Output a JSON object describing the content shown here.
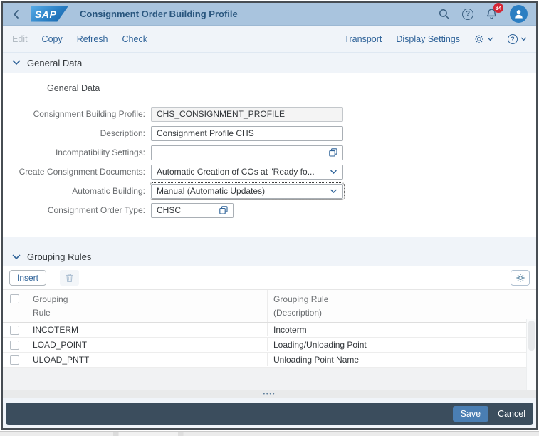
{
  "colors": {
    "shell_bg": "#a9c4de",
    "link_blue": "#2f6399",
    "badge_red": "#d32433",
    "footer_bg": "#3b4d5d",
    "save_button": "#4a7eb3",
    "page_bg": "#f0f4f9"
  },
  "shell": {
    "logo_text": "SAP",
    "title": "Consignment Order Building Profile",
    "notification_count": "84"
  },
  "toolbar": {
    "edit": "Edit",
    "copy": "Copy",
    "refresh": "Refresh",
    "check": "Check",
    "transport": "Transport",
    "display_settings": "Display Settings"
  },
  "general": {
    "section_title": "General Data",
    "group_title": "General Data",
    "fields": [
      {
        "label": "Consignment Building Profile:",
        "value": "CHS_CONSIGNMENT_PROFILE"
      },
      {
        "label": "Description:",
        "value": "Consignment Profile CHS"
      },
      {
        "label": "Incompatibility Settings:",
        "value": ""
      },
      {
        "label": "Create Consignment Documents:",
        "value": "Automatic Creation of COs at \"Ready fo..."
      },
      {
        "label": "Automatic Building:",
        "value": "Manual (Automatic Updates)"
      },
      {
        "label": "Consignment Order Type:",
        "value": "CHSC"
      }
    ]
  },
  "grouping": {
    "section_title": "Grouping Rules",
    "insert_label": "Insert",
    "columns": [
      {
        "line1": "Grouping",
        "line2": "Rule"
      },
      {
        "line1": "Grouping Rule",
        "line2": "(Description)"
      }
    ],
    "rows": [
      {
        "rule": "INCOTERM",
        "description": "Incoterm"
      },
      {
        "rule": "LOAD_POINT",
        "description": "Loading/Unloading Point"
      },
      {
        "rule": "ULOAD_PNTT",
        "description": "Unloading Point Name"
      }
    ]
  },
  "footer": {
    "save": "Save",
    "cancel": "Cancel"
  }
}
